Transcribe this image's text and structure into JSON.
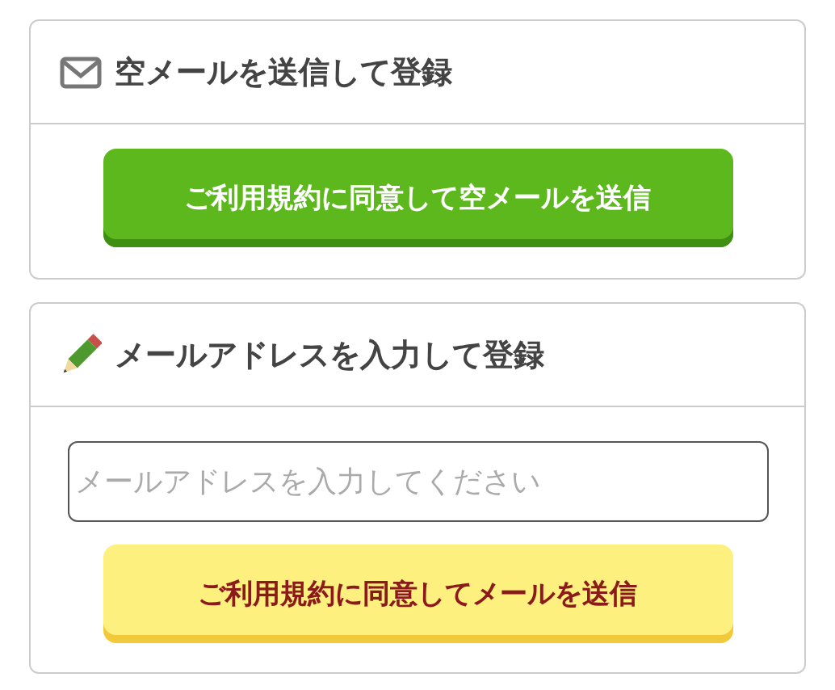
{
  "sections": [
    {
      "kind": "mail",
      "title": "空メールを送信して登録",
      "button": "ご利用規約に同意して空メールを送信"
    },
    {
      "kind": "form",
      "title": "メールアドレスを入力して登録",
      "placeholder": "メールアドレスを入力してください",
      "button": "ご利用規約に同意してメールを送信"
    }
  ]
}
